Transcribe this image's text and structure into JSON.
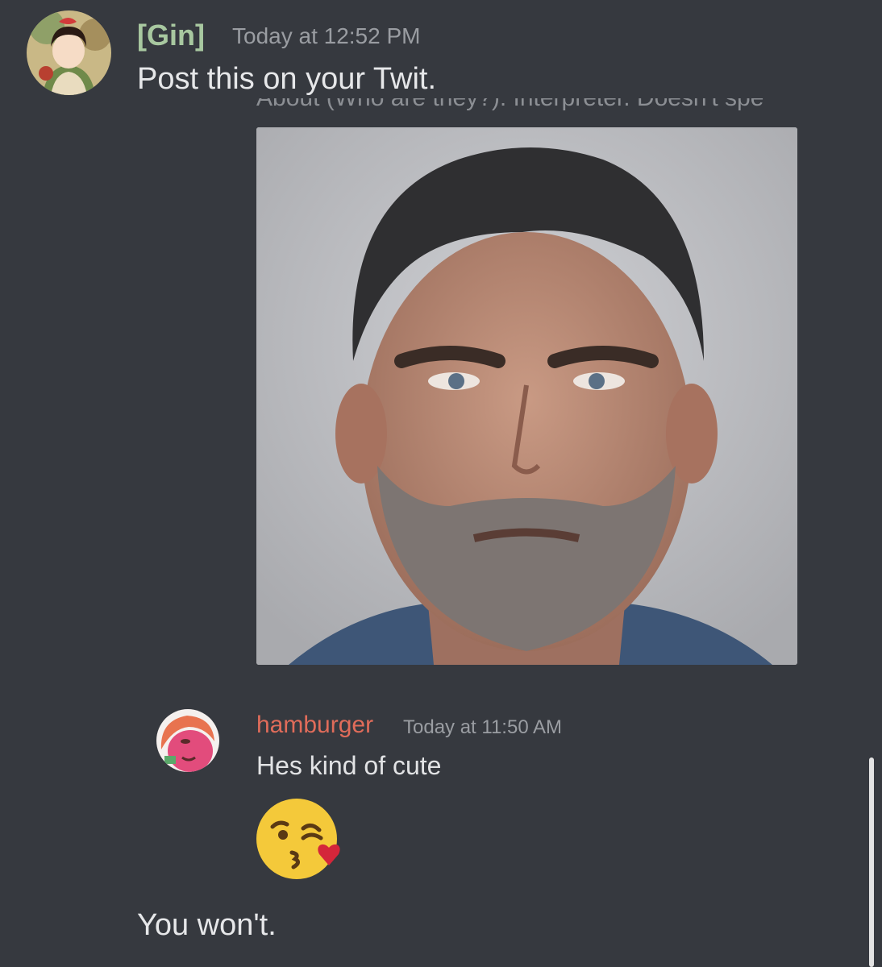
{
  "message": {
    "author": "[Gin]",
    "timestamp": "Today at 12:52 PM",
    "text_1": "Post this on your Twit.",
    "text_2": "You won't."
  },
  "screenshot": {
    "cropped_header_text": "About (Who are they?): Interpreter. Doesn't spe",
    "reply_author": "hamburger",
    "reply_timestamp": "Today at 11:50 AM",
    "reply_text": "Hes kind of cute",
    "reply_emoji": "face-blowing-a-kiss-emoji"
  },
  "colors": {
    "background": "#36393f",
    "gin_name": "#a8c8a0",
    "hamburger_name": "#e06c5a",
    "timestamp": "#9a9da2"
  }
}
